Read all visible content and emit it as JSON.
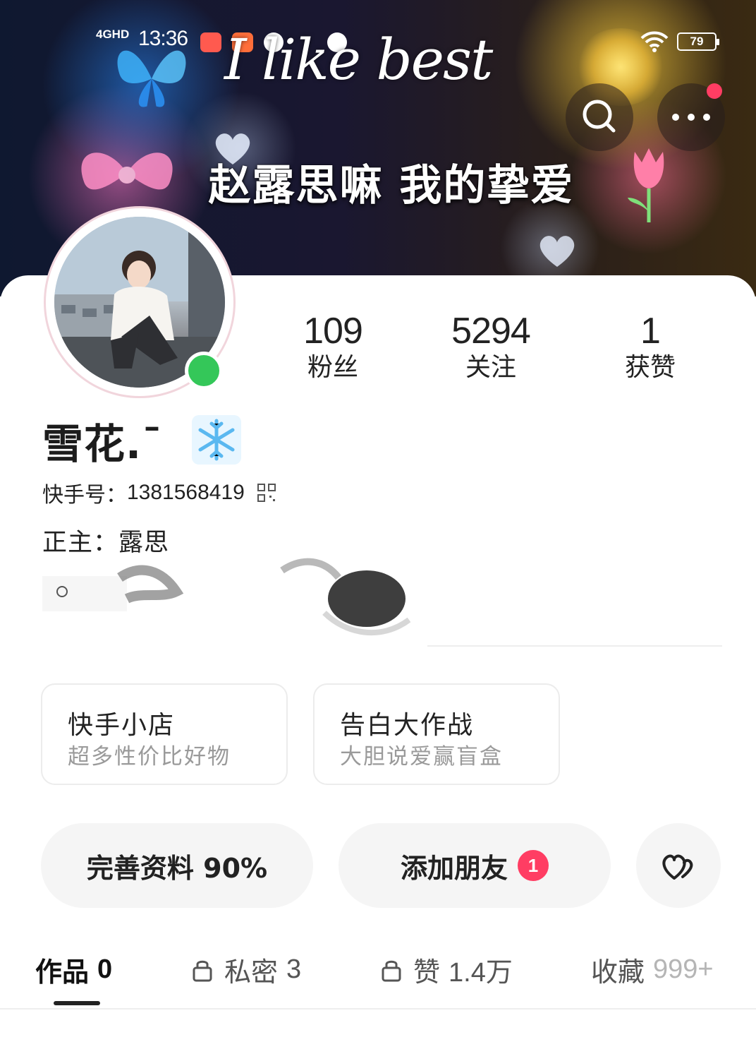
{
  "status_bar": {
    "signal": "4GHD",
    "time": "13:36",
    "battery": "79"
  },
  "banner": {
    "script_text": "I like best",
    "caption": "赵露思嘛 我的挚爱"
  },
  "profile": {
    "stats": [
      {
        "value": "109",
        "label": "粉丝"
      },
      {
        "value": "5294",
        "label": "关注"
      },
      {
        "value": "1",
        "label": "获赞"
      }
    ],
    "username": "雪花.ˉ",
    "kuaishou_id_label": "快手号：",
    "kuaishou_id": "1381568419",
    "owner_line": "正主：露思",
    "online": true
  },
  "promos": [
    {
      "title": "快手小店",
      "subtitle": "超多性价比好物"
    },
    {
      "title": "告白大作战",
      "subtitle": "大胆说爱赢盲盒"
    }
  ],
  "actions": {
    "complete_profile": "完善资料 90%",
    "add_friends": "添加朋友",
    "add_friends_badge": "1"
  },
  "tabs": [
    {
      "label": "作品",
      "count": "0",
      "locked": false,
      "active": true
    },
    {
      "label": "私密",
      "count": "3",
      "locked": true,
      "active": false
    },
    {
      "label": "赞",
      "count": "1.4万",
      "locked": true,
      "active": false
    },
    {
      "label": "收藏",
      "count": "999+",
      "locked": false,
      "active": false
    }
  ],
  "icons": {
    "search": "search-icon",
    "more": "more-icon",
    "qr": "qr-code-icon",
    "snowflake": "snowflake-icon",
    "lock": "lock-icon",
    "like": "heart-icon"
  },
  "colors": {
    "accent": "#ff3d63",
    "online": "#34c759",
    "pill_bg": "#f5f5f5"
  }
}
